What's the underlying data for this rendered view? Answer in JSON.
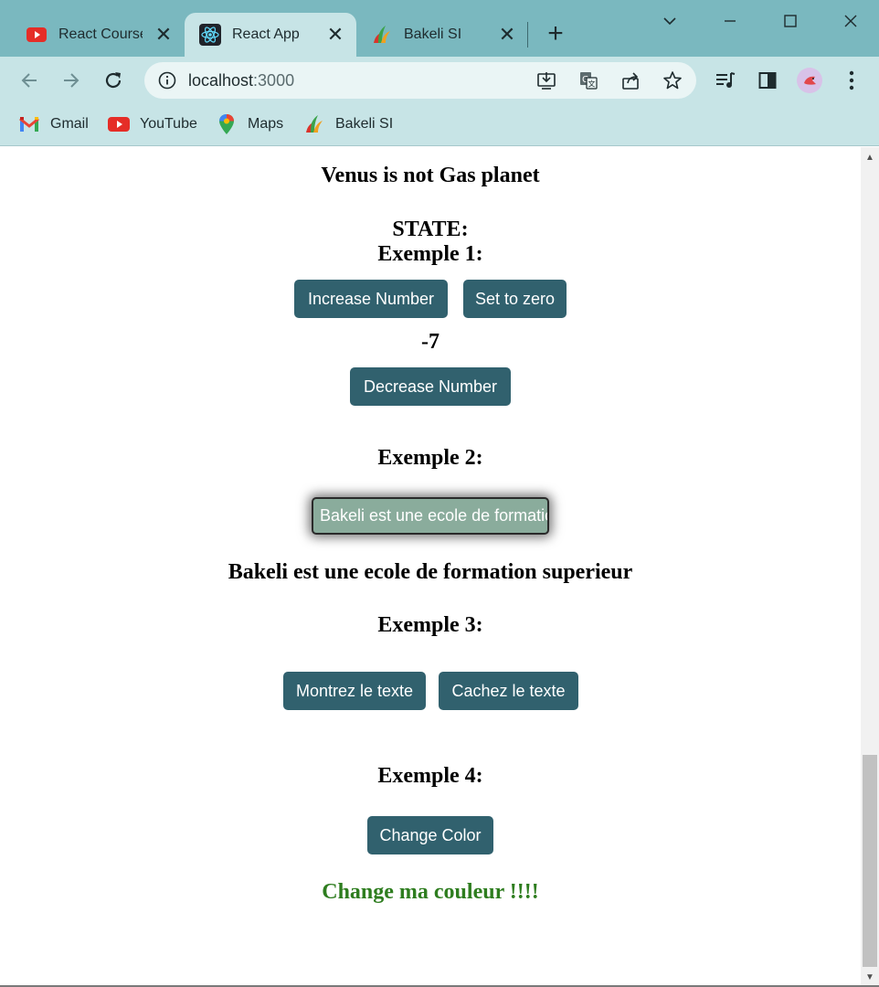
{
  "browser": {
    "tabs": [
      {
        "title": "React Course",
        "icon": "youtube-icon",
        "active": false
      },
      {
        "title": "React App",
        "icon": "react-icon",
        "active": true
      },
      {
        "title": "Bakeli SI",
        "icon": "bakeli-icon",
        "active": false
      }
    ],
    "url": {
      "host": "localhost",
      "path": ":3000"
    },
    "bookmarks": [
      {
        "label": "Gmail",
        "icon": "gmail-icon"
      },
      {
        "label": "YouTube",
        "icon": "youtube-icon"
      },
      {
        "label": "Maps",
        "icon": "maps-icon"
      },
      {
        "label": "Bakeli SI",
        "icon": "bakeli-icon"
      }
    ]
  },
  "page": {
    "planet_text": "Venus is not Gas planet",
    "state_heading": "STATE:",
    "example1": {
      "heading": "Exemple 1:",
      "increase_label": "Increase Number",
      "zero_label": "Set to zero",
      "counter": "-7",
      "decrease_label": "Decrease Number"
    },
    "example2": {
      "heading": "Exemple 2:",
      "input_value": "Bakeli est une ecole de formation superieur",
      "output_text": "Bakeli est une ecole de formation superieur"
    },
    "example3": {
      "heading": "Exemple 3:",
      "show_label": "Montrez le texte",
      "hide_label": "Cachez le texte"
    },
    "example4": {
      "heading": "Exemple 4:",
      "change_label": "Change Color",
      "colored_text": "Change ma couleur !!!!",
      "text_color": "#2e7d1f"
    }
  },
  "colors": {
    "button_bg": "#31616e",
    "tabstrip_bg": "#7ab8bf",
    "toolbar_bg": "#c7e4e6"
  }
}
